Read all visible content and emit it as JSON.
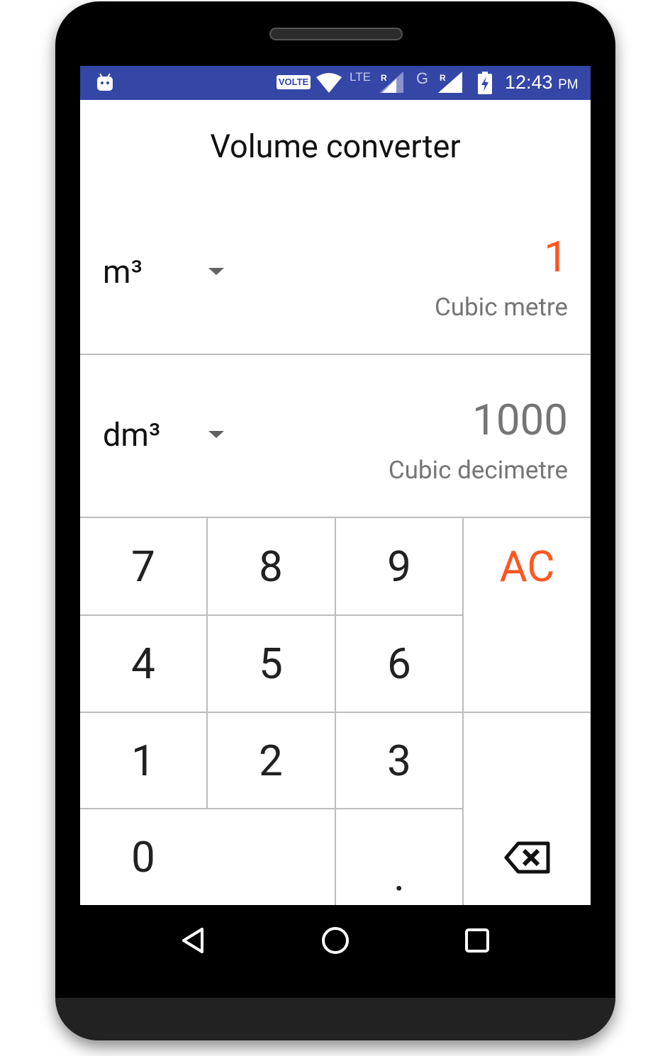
{
  "status_bar": {
    "volte": "VOLTE",
    "lte": "LTE",
    "roaming1": "R",
    "network2": "G",
    "roaming2": "R",
    "time": "12:43",
    "ampm": "PM"
  },
  "app": {
    "title": "Volume converter"
  },
  "from": {
    "unit_symbol": "m³",
    "value": "1",
    "unit_name": "Cubic metre",
    "value_color": "#ff5722"
  },
  "to": {
    "unit_symbol": "dm³",
    "value": "1000",
    "unit_name": "Cubic decimetre",
    "value_color": "#757575"
  },
  "keypad": {
    "k7": "7",
    "k8": "8",
    "k9": "9",
    "clear": "AC",
    "k4": "4",
    "k5": "5",
    "k6": "6",
    "k1": "1",
    "k2": "2",
    "k3": "3",
    "k0": "0",
    "dot": ".",
    "backspace_icon": "backspace-icon",
    "clear_color": "#ff5722"
  },
  "colors": {
    "status_bar": "#3446a6",
    "accent": "#ff5722",
    "divider": "#bdbdbd"
  },
  "nav_icons": [
    "back-icon",
    "home-icon",
    "recents-icon"
  ]
}
